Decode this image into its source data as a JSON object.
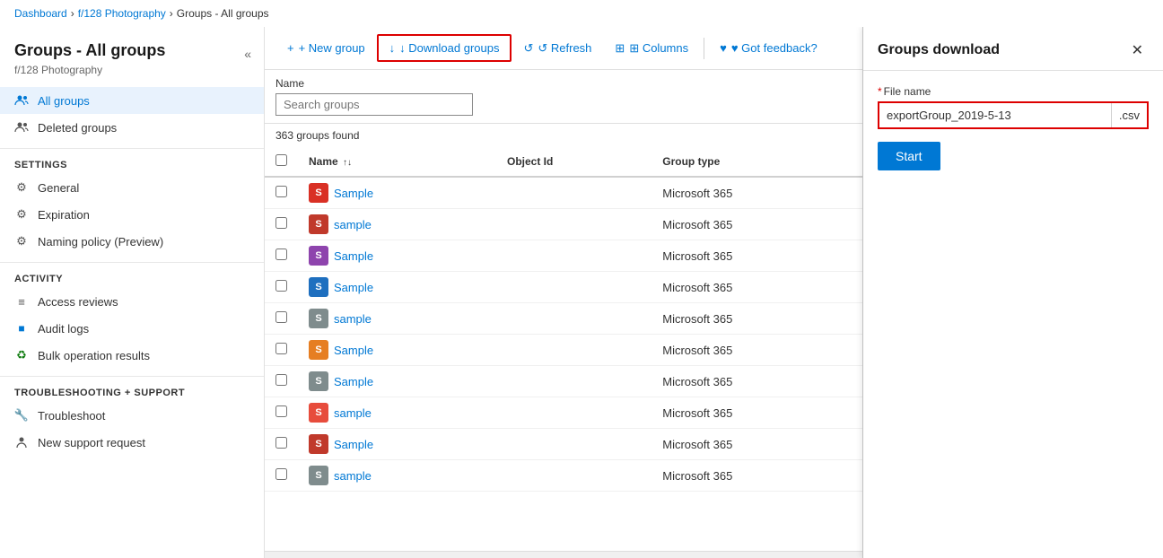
{
  "breadcrumb": {
    "items": [
      "Dashboard",
      "f/128 Photography",
      "Groups - All groups"
    ]
  },
  "sidebar": {
    "title": "Groups - All groups",
    "subtitle": "f/128 Photography",
    "collapse_label": "«",
    "nav_items": [
      {
        "id": "all-groups",
        "label": "All groups",
        "icon": "users",
        "active": true
      },
      {
        "id": "deleted-groups",
        "label": "Deleted groups",
        "icon": "users-deleted",
        "active": false
      }
    ],
    "sections": [
      {
        "title": "Settings",
        "items": [
          {
            "id": "general",
            "label": "General",
            "icon": "gear"
          },
          {
            "id": "expiration",
            "label": "Expiration",
            "icon": "gear"
          },
          {
            "id": "naming-policy",
            "label": "Naming policy (Preview)",
            "icon": "gear"
          }
        ]
      },
      {
        "title": "Activity",
        "items": [
          {
            "id": "access-reviews",
            "label": "Access reviews",
            "icon": "list"
          },
          {
            "id": "audit-logs",
            "label": "Audit logs",
            "icon": "square"
          },
          {
            "id": "bulk-operation",
            "label": "Bulk operation results",
            "icon": "recycle"
          }
        ]
      },
      {
        "title": "Troubleshooting + Support",
        "items": [
          {
            "id": "troubleshoot",
            "label": "Troubleshoot",
            "icon": "wrench"
          },
          {
            "id": "new-support",
            "label": "New support request",
            "icon": "person-support"
          }
        ]
      }
    ]
  },
  "toolbar": {
    "new_group_label": "+ New group",
    "download_label": "↓ Download groups",
    "refresh_label": "↺ Refresh",
    "columns_label": "⊞ Columns",
    "feedback_label": "♥ Got feedback?"
  },
  "filter": {
    "label": "Name",
    "placeholder": "Search groups"
  },
  "results": {
    "count_text": "363 groups found"
  },
  "table": {
    "columns": [
      "Name ↑↓",
      "Object Id",
      "Group type"
    ],
    "rows": [
      {
        "name": "Sample",
        "color": "#d93025",
        "object_id": "",
        "group_type": "Microsoft 365"
      },
      {
        "name": "sample",
        "color": "#c0392b",
        "object_id": "",
        "group_type": "Microsoft 365"
      },
      {
        "name": "Sample",
        "color": "#8e44ad",
        "object_id": "",
        "group_type": "Microsoft 365"
      },
      {
        "name": "Sample",
        "color": "#1e6fbf",
        "object_id": "",
        "group_type": "Microsoft 365"
      },
      {
        "name": "sample",
        "color": "#7f8c8d",
        "object_id": "",
        "group_type": "Microsoft 365"
      },
      {
        "name": "Sample",
        "color": "#e67e22",
        "object_id": "",
        "group_type": "Microsoft 365"
      },
      {
        "name": "Sample",
        "color": "#7f8c8d",
        "object_id": "",
        "group_type": "Microsoft 365"
      },
      {
        "name": "sample",
        "color": "#e74c3c",
        "object_id": "",
        "group_type": "Microsoft 365"
      },
      {
        "name": "Sample",
        "color": "#c0392b",
        "object_id": "",
        "group_type": "Microsoft 365"
      },
      {
        "name": "sample",
        "color": "#7f8c8d",
        "object_id": "",
        "group_type": "Microsoft 365"
      }
    ]
  },
  "right_panel": {
    "title": "Groups download",
    "close_label": "✕",
    "field_label": "File name",
    "filename_value": "exportGroup_2019-5-13",
    "filename_ext": ".csv",
    "start_label": "Start"
  }
}
